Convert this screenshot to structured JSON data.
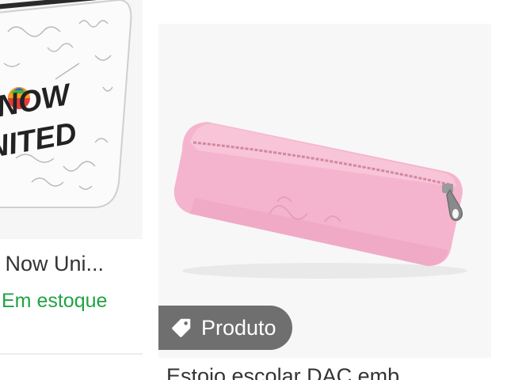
{
  "products": [
    {
      "title": "- Now Uni...",
      "stock_status": "Em estoque",
      "print_text": {
        "line1": "NOW",
        "line2": "UNITED"
      }
    },
    {
      "badge_label": "Produto",
      "badge_icon": "tag-icon",
      "title": "Estojo escolar DAC emb..."
    }
  ],
  "colors": {
    "stock_green": "#1fa344",
    "badge_gray": "#6f6f6f",
    "pencil_case_pink": "#f4b3cc",
    "text_dark": "#333333"
  }
}
